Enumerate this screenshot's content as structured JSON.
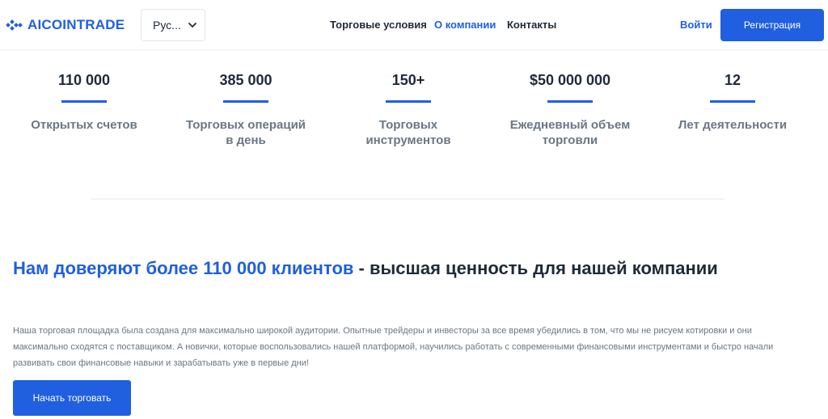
{
  "header": {
    "logo_text": "AICOINTRADE",
    "language_selected": "Рус...",
    "nav": [
      {
        "label": "Торговые условия",
        "active": false
      },
      {
        "label": "О компании",
        "active": true
      },
      {
        "label": "Контакты",
        "active": false
      }
    ],
    "login_label": "Войти",
    "register_label": "Регистрация"
  },
  "stats": [
    {
      "value": "110 000",
      "label_line1": "Открытых счетов",
      "label_line2": ""
    },
    {
      "value": "385 000",
      "label_line1": "Торговых операций",
      "label_line2": "в день"
    },
    {
      "value": "150+",
      "label_line1": "Торговых",
      "label_line2": "инструментов"
    },
    {
      "value": "$50 000 000",
      "label_line1": "Ежедневный объем",
      "label_line2": "торговли"
    },
    {
      "value": "12",
      "label_line1": "Лет деятельности",
      "label_line2": ""
    }
  ],
  "main": {
    "heading_highlight": "Нам доверяют более 110 000 клиентов",
    "heading_rest": " - высшая ценность для нашей компании",
    "paragraph": "Наша торговая площадка была создана для максимально широкой аудитории. Опытные трейдеры и инвесторы за все время убедились в том, что мы не рисуем котировки и они максимально сходятся с поставщиком. А новички, которые воспользовались нашей платформой, научились работать с современными финансовыми инструментами и быстро начали развивать свои финансовые навыки и зарабатывать уже в первые дни!",
    "cta_label": "Начать торговать"
  },
  "colors": {
    "accent": "#1f5fe0",
    "text_dark": "#1f2a37",
    "text_muted": "#6b7683"
  },
  "icons": {
    "logo": "diamond-cluster-icon",
    "language_dropdown": "chevron-down-icon"
  }
}
